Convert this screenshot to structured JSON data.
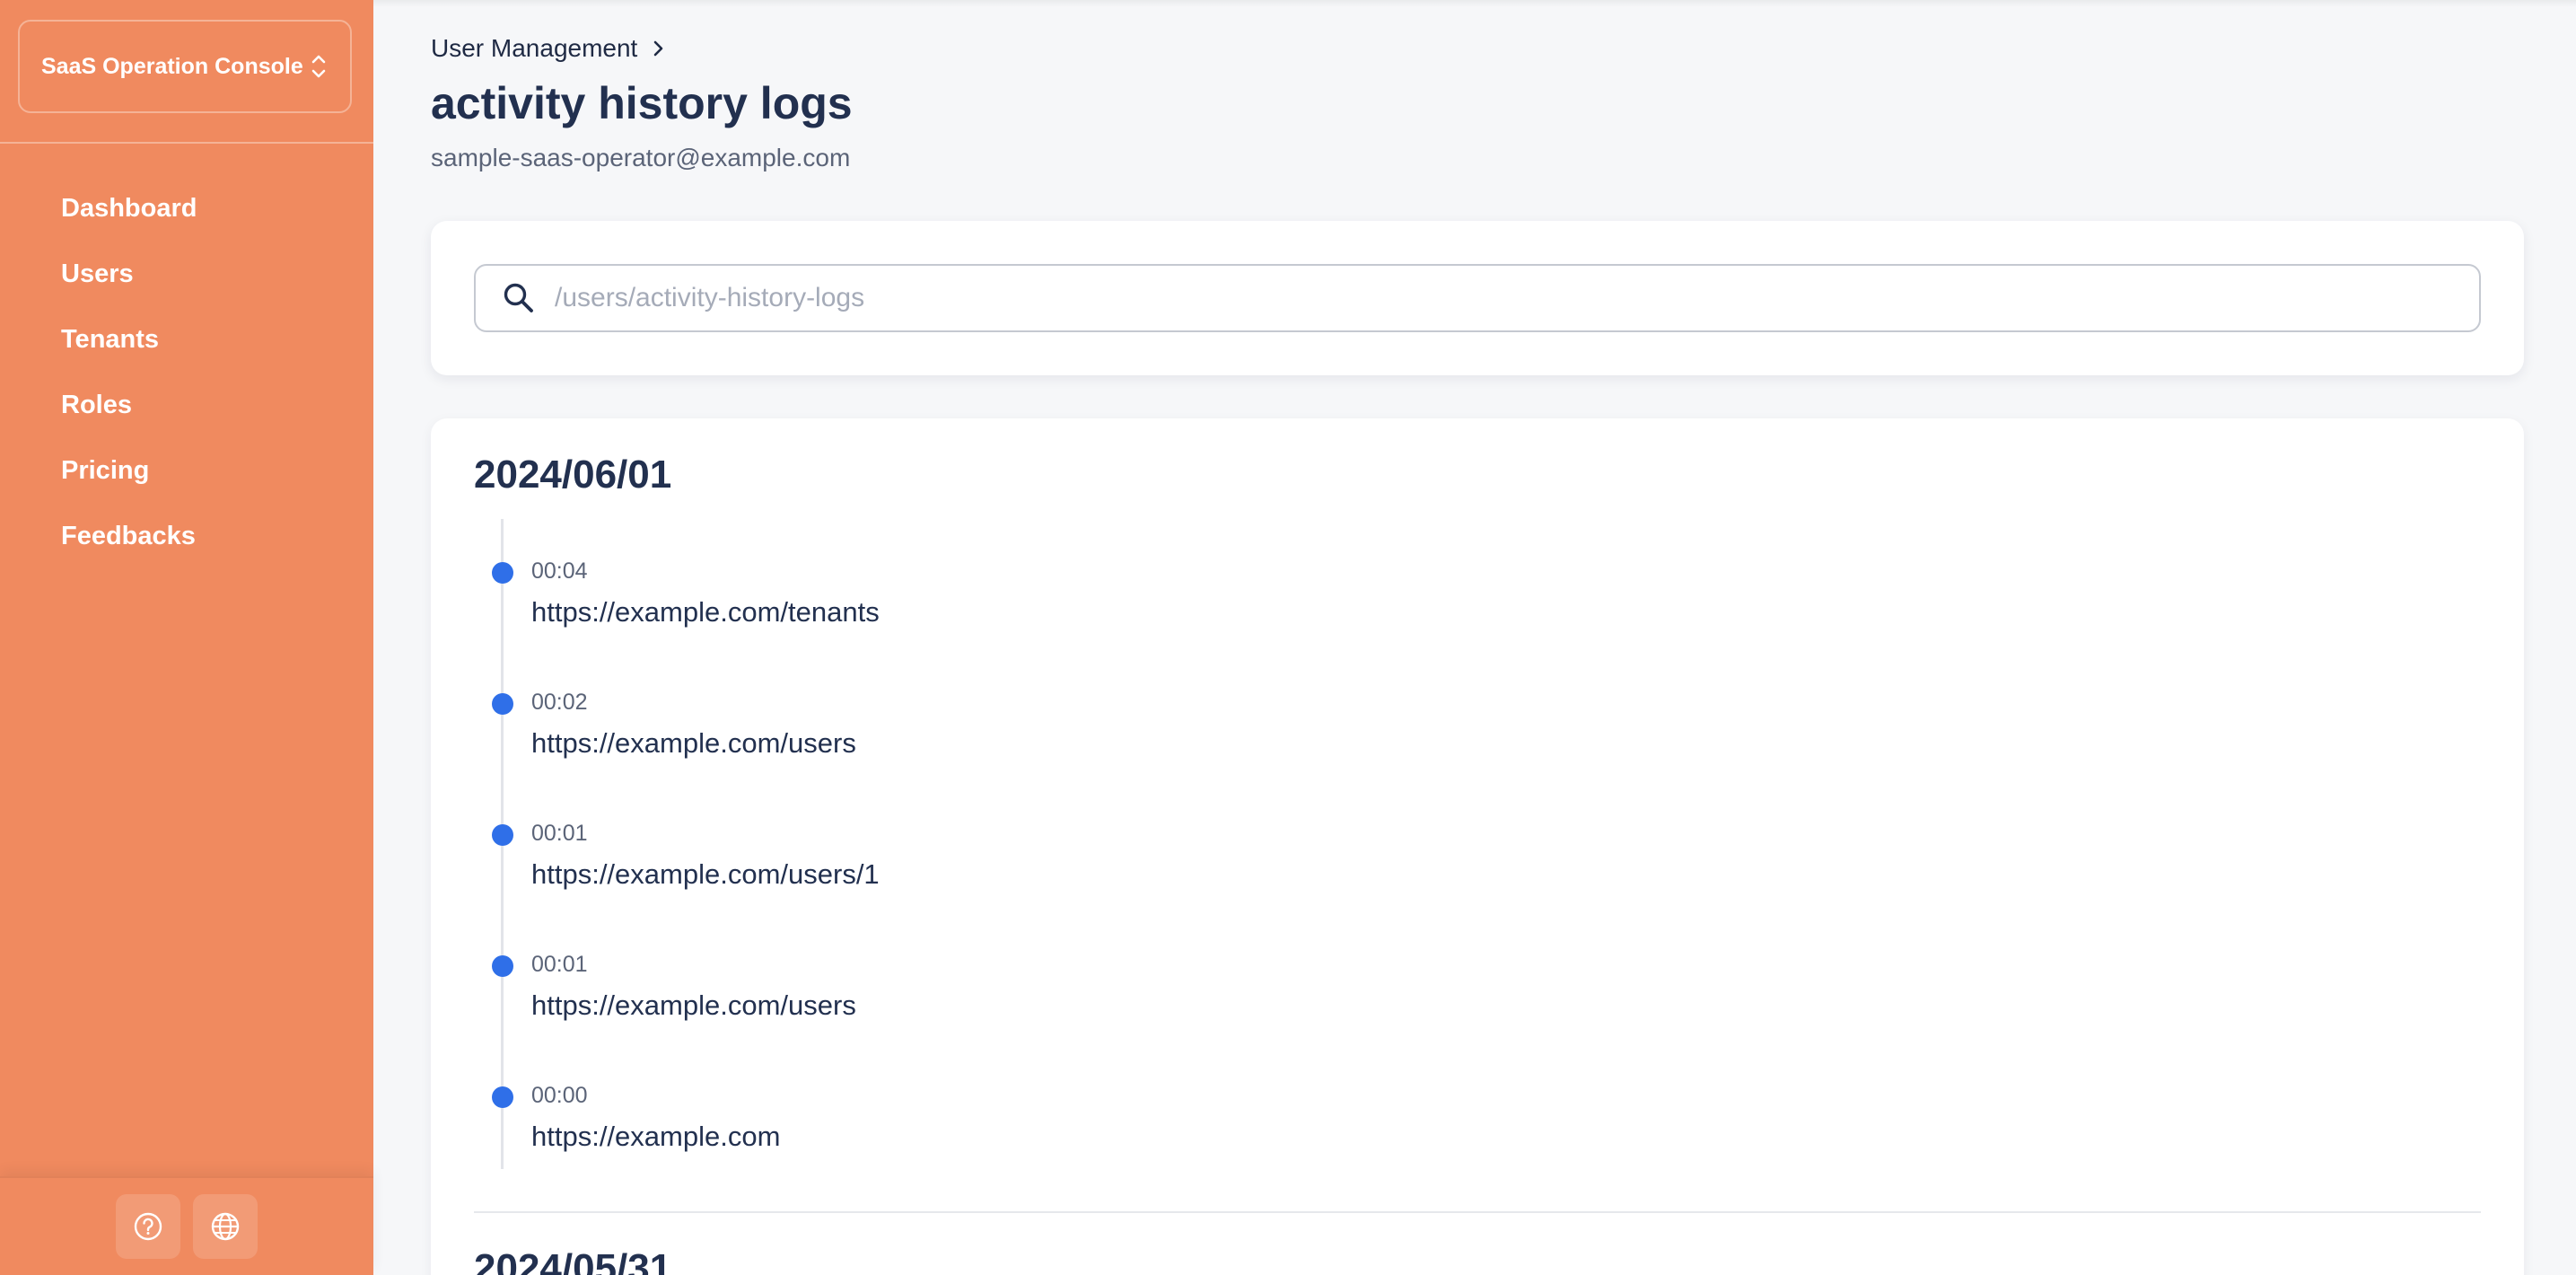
{
  "sidebar": {
    "console_name": "SaaS Operation Console",
    "nav_items": [
      {
        "label": "Dashboard"
      },
      {
        "label": "Users"
      },
      {
        "label": "Tenants"
      },
      {
        "label": "Roles"
      },
      {
        "label": "Pricing"
      },
      {
        "label": "Feedbacks"
      }
    ],
    "footer_icons": [
      "help-icon",
      "globe-icon"
    ]
  },
  "header": {
    "breadcrumb": "User Management",
    "title": "activity history logs",
    "subtitle": "sample-saas-operator@example.com"
  },
  "search": {
    "placeholder": "/users/activity-history-logs",
    "value": ""
  },
  "log_groups": [
    {
      "date": "2024/06/01",
      "entries": [
        {
          "time": "00:04",
          "url": "https://example.com/tenants"
        },
        {
          "time": "00:02",
          "url": "https://example.com/users"
        },
        {
          "time": "00:01",
          "url": "https://example.com/users/1"
        },
        {
          "time": "00:01",
          "url": "https://example.com/users"
        },
        {
          "time": "00:00",
          "url": "https://example.com"
        }
      ]
    },
    {
      "date": "2024/05/31",
      "entries": []
    }
  ],
  "colors": {
    "sidebar": "#f08a5f",
    "accent_dot": "#2f6fe8",
    "text_primary": "#22304f"
  }
}
